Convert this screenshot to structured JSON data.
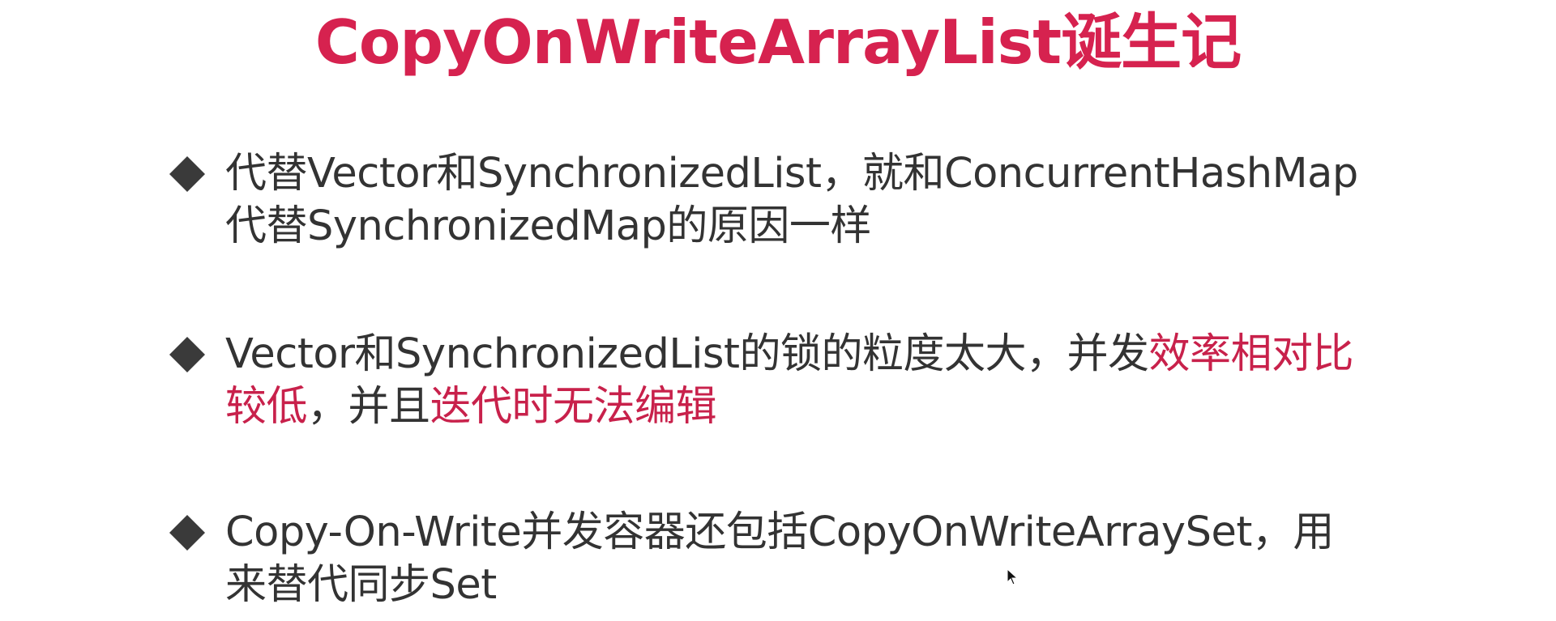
{
  "slide": {
    "title": "CopyOnWriteArrayList诞生记",
    "bullets": [
      {
        "icon": "diamond-bullet-icon",
        "line1": "代替Vector和SynchronizedList，就和ConcurrentHashMap",
        "line2": "代替SynchronizedMap的原因一样"
      },
      {
        "icon": "diamond-bullet-icon",
        "line1_plain": "Vector和SynchronizedList的锁的粒度太大，并发",
        "line1_em": "效率相对比",
        "line2_em_1": "较低",
        "line2_plain": "，并且",
        "line2_em_2": "迭代时无法编辑"
      },
      {
        "icon": "diamond-bullet-icon",
        "line1": "Copy-On-Write并发容器还包括CopyOnWriteArraySet，用",
        "line2": "来替代同步Set"
      }
    ]
  },
  "colors": {
    "title": "#d6224f",
    "emphasis": "#c8214b",
    "body_text": "#333333",
    "bullet_icon": "#3a3a3a",
    "background": "#ffffff"
  },
  "cursor": {
    "icon": "mouse-pointer-icon"
  }
}
